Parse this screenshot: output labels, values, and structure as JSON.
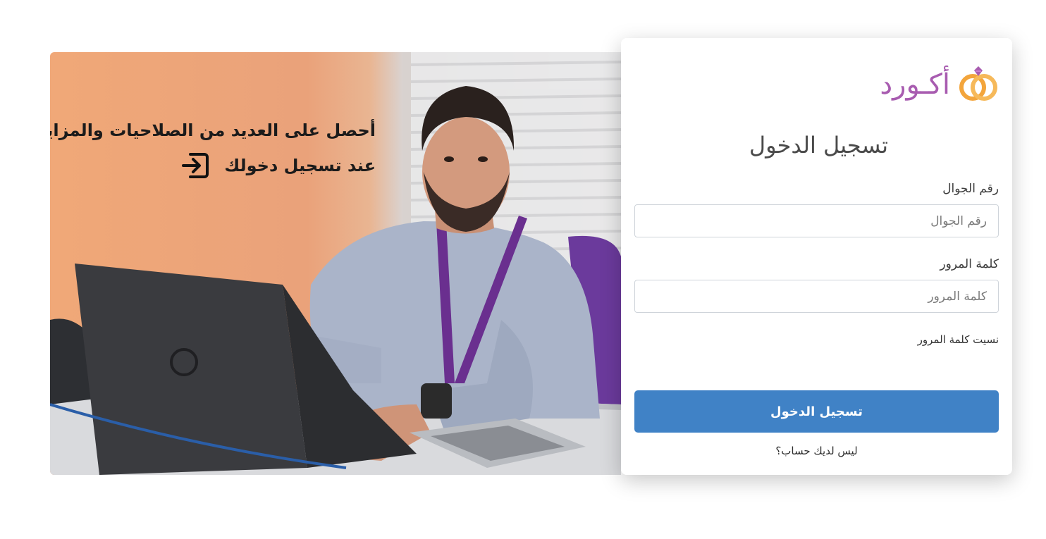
{
  "promo": {
    "line1": "أحصل على العديد من الصلاحيات والمزايا",
    "line2": "عند تسجيل دخولك",
    "icon": "login-icon",
    "image": "man-at-laptop-photo"
  },
  "brand": {
    "logo_text": "أكـورد",
    "logo_icon": "rings-icon",
    "colors": {
      "purple": "#a85cb0",
      "orange": "#f3a53c"
    }
  },
  "login": {
    "title": "تسجيل الدخول",
    "phone_label": "رقم الجوال",
    "phone_placeholder": "رقم الجوال",
    "phone_value": "",
    "password_label": "كلمة المرور",
    "password_placeholder": "كلمة المرور",
    "password_value": "",
    "forgot_password": "نسيت كلمة المرور",
    "submit_label": "تسجيل الدخول",
    "no_account": "ليس لديك حساب؟",
    "button_color": "#4082c6"
  }
}
